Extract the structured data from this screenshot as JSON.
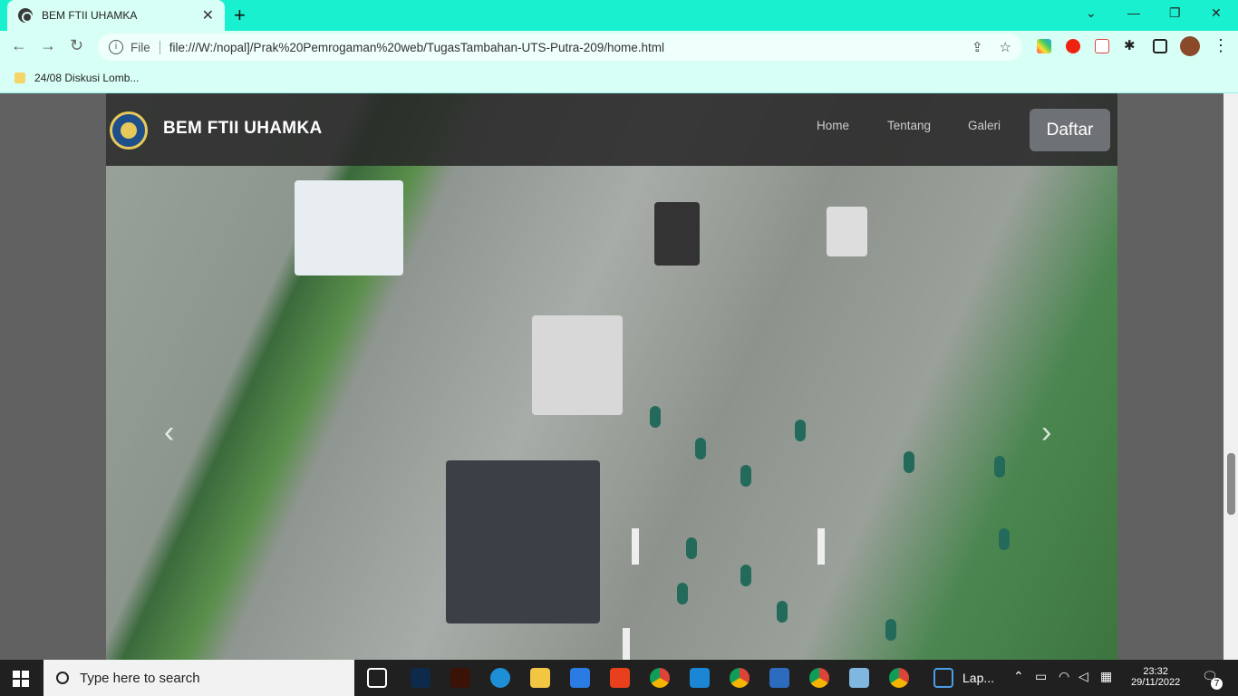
{
  "browser": {
    "tab_title": "BEM FTII UHAMKA",
    "tab_close": "✕",
    "new_tab": "+",
    "url_scheme_label": "File",
    "url": "file:///W:/nopal]/Prak%20Pemrogaman%20web/TugasTambahan-UTS-Putra-209/home.html",
    "bookmark": "24/08 Diskusi Lomb..."
  },
  "site": {
    "brand": "BEM FTII UHAMKA",
    "nav": [
      "Home",
      "Tentang",
      "Galeri"
    ],
    "cta": "Daftar",
    "prev": "‹",
    "next": "›"
  },
  "taskbar": {
    "search_placeholder": "Type here to search",
    "pinned_label": "Lap...",
    "time": "23:32",
    "date": "29/11/2022",
    "notification_count": "7"
  },
  "colors": {
    "browser_chrome": "#1ef5d2",
    "navbar": "#282828",
    "cta": "#6e7175"
  }
}
